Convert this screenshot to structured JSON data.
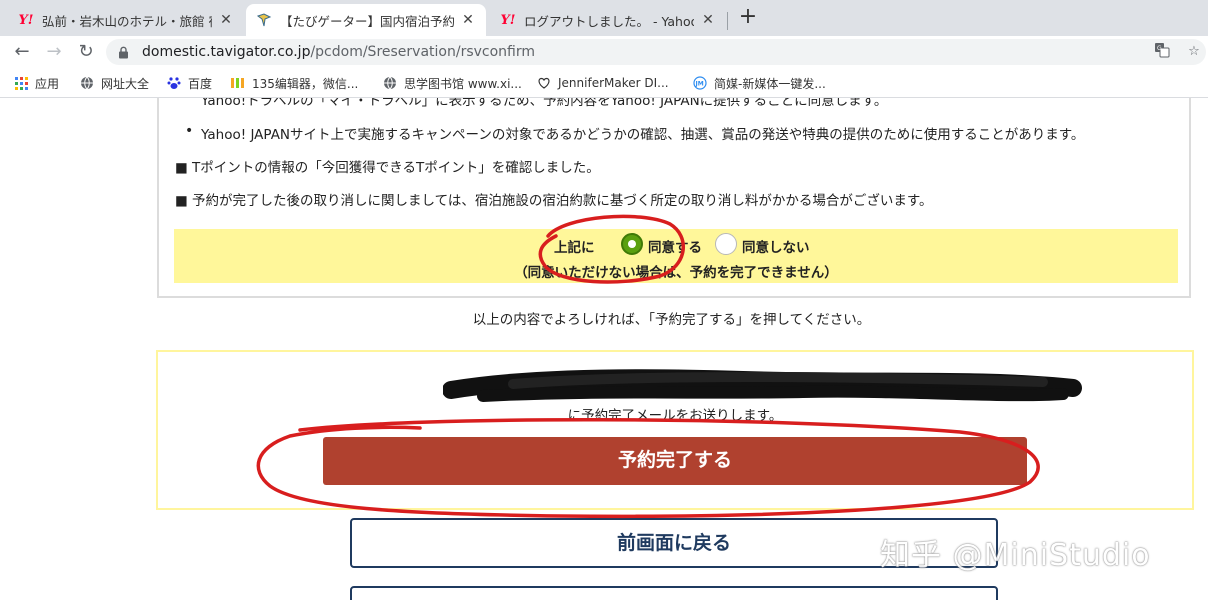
{
  "browser": {
    "tabs": [
      {
        "title": "弘前・岩木山のホテル・旅館 宿",
        "favicon": "yahoo-icon",
        "active": false
      },
      {
        "title": "【たびゲーター】国内宿泊予約",
        "favicon": "tabigator-icon",
        "active": true
      },
      {
        "title": "ログアウトしました。 - Yahoo!",
        "favicon": "yahoo-icon",
        "active": false
      }
    ],
    "url_domain": "domestic.tavigator.co.jp",
    "url_path": "/pcdom/Sreservation/rsvconfirm",
    "bookmarks": [
      {
        "label": "应用",
        "icon": "apps-grid-icon"
      },
      {
        "label": "网址大全",
        "icon": "globe-icon"
      },
      {
        "label": "百度",
        "icon": "baidu-paw-icon"
      },
      {
        "label": "135编辑器，微信...",
        "icon": "135-editor-icon"
      },
      {
        "label": "思学图书馆 www.xi...",
        "icon": "globe-icon"
      },
      {
        "label": "JenniferMaker DI...",
        "icon": "heart-scissors-icon"
      },
      {
        "label": "简媒-新媒体一键发...",
        "icon": "jm-circle-icon"
      }
    ]
  },
  "terms": {
    "bullets": [
      "Yahoo!トラベルの「マイ・トラベル」に表示するため、予約内容をYahoo! JAPANに提供することに同意します。",
      "Yahoo! JAPANサイト上で実施するキャンペーンの対象であるかどうかの確認、抽選、賞品の発送や特典の提供のために使用することがあります。"
    ],
    "notes": [
      "■ Tポイントの情報の「今回獲得できるTポイント」を確認しました。",
      "■ 予約が完了した後の取り消しに関しましては、宿泊施設の宿泊約款に基づく所定の取り消し料がかかる場合がございます。"
    ]
  },
  "agreement": {
    "prefix": "上記に",
    "agree_label": "同意する",
    "disagree_label": "同意しない",
    "selected": "agree",
    "warning": "（同意いただけない場合は、予約を完了できません）"
  },
  "instruction": "以上の内容でよろしければ、「予約完了する」を押してください。",
  "confirm": {
    "mail_note": "に予約完了メールをお送りします。",
    "complete_button": "予約完了する",
    "back_button": "前画面に戻る"
  },
  "watermark": "知乎 @MiniStudio",
  "colors": {
    "complete_button": "#b0412f",
    "agree_panel": "#fff79a",
    "radio_selected": "#5aa00f",
    "back_button_border": "#1f3a5f",
    "annotation_red": "#d81e1e"
  }
}
